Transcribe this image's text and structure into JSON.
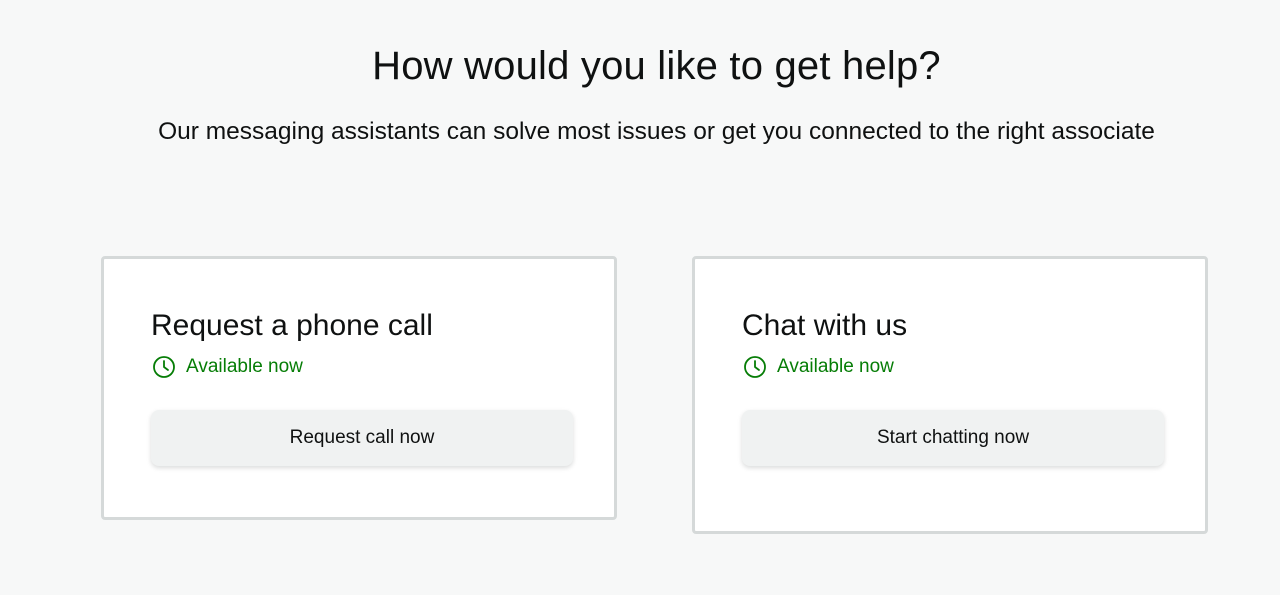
{
  "header": {
    "title": "How would you like to get help?",
    "subtitle": "Our messaging assistants can solve most issues or get you connected to the right associate"
  },
  "options": [
    {
      "title": "Request a phone call",
      "status_icon": "clock-icon",
      "status": "Available now",
      "button_label": "Request call now"
    },
    {
      "title": "Chat with us",
      "status_icon": "clock-icon",
      "status": "Available now",
      "button_label": "Start chatting now"
    }
  ],
  "colors": {
    "status_green": "#067d06",
    "card_border": "#d5d9d9",
    "button_bg": "#f0f2f2",
    "page_bg": "#f7f8f8"
  }
}
